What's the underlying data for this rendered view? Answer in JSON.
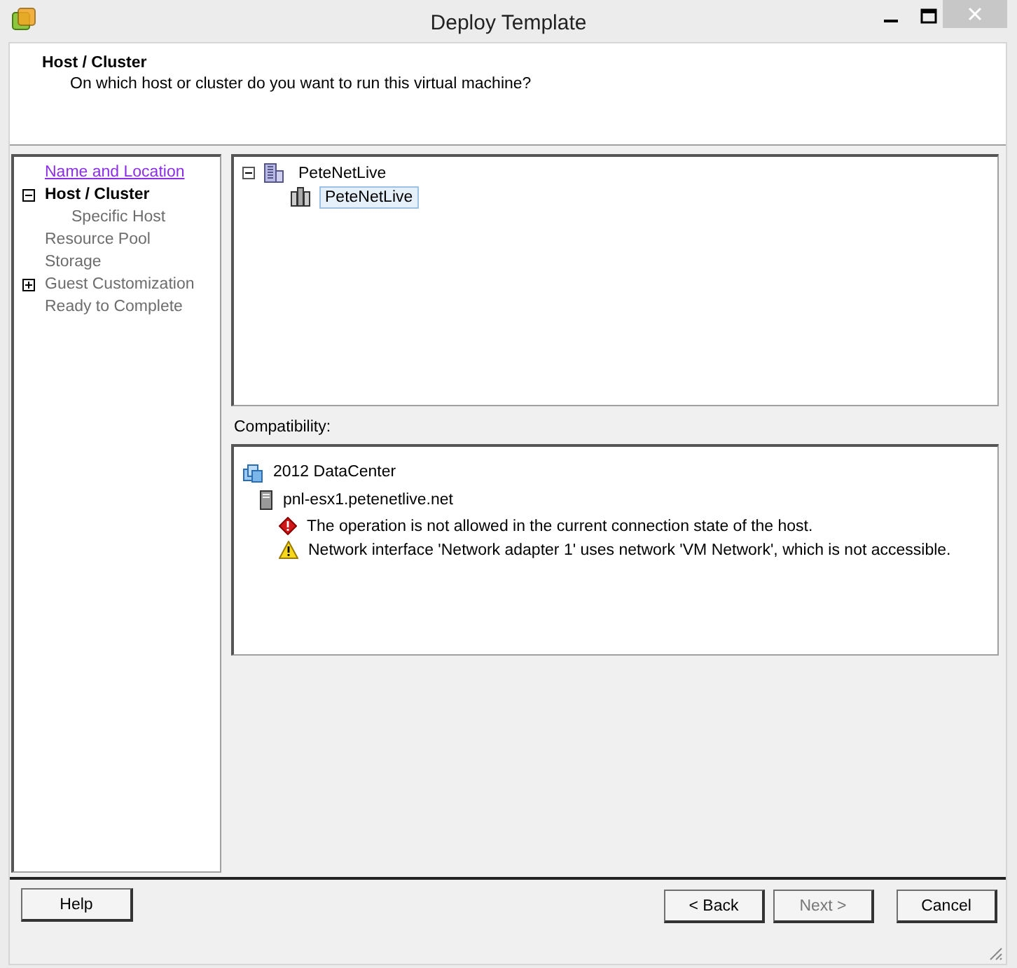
{
  "window": {
    "title": "Deploy Template"
  },
  "header": {
    "title": "Host / Cluster",
    "subtitle": "On which host or cluster do you want to run this virtual machine?"
  },
  "steps": [
    {
      "label": "Name and Location",
      "kind": "visited"
    },
    {
      "label": "Host / Cluster",
      "kind": "current",
      "expanded": true,
      "children": [
        {
          "label": "Specific Host",
          "kind": "pending"
        }
      ]
    },
    {
      "label": "Resource Pool",
      "kind": "pending"
    },
    {
      "label": "Storage",
      "kind": "pending"
    },
    {
      "label": "Guest Customization",
      "kind": "pending",
      "expanded": false
    },
    {
      "label": "Ready to Complete",
      "kind": "pending"
    }
  ],
  "tree": [
    {
      "label": "PeteNetLive",
      "kind": "datacenter",
      "expanded": true,
      "selected": false,
      "children": [
        {
          "label": "PeteNetLive",
          "kind": "cluster",
          "selected": true
        }
      ]
    }
  ],
  "compatibility": {
    "label": "Compatibility:",
    "items": [
      {
        "kind": "datacenter",
        "text": "2012 DataCenter",
        "children": [
          {
            "kind": "host",
            "text": "pnl-esx1.petenetlive.net",
            "children": [
              {
                "kind": "error",
                "text": "The operation is not allowed in the current connection state of the host."
              },
              {
                "kind": "warning",
                "text": "Network interface 'Network adapter 1' uses network 'VM Network', which is not accessible."
              }
            ]
          }
        ]
      }
    ]
  },
  "buttons": [
    {
      "label": "Help",
      "disabled": false
    },
    {
      "label": "< Back",
      "disabled": false
    },
    {
      "label": "Next >",
      "disabled": true
    },
    {
      "label": "Cancel",
      "disabled": false
    }
  ]
}
